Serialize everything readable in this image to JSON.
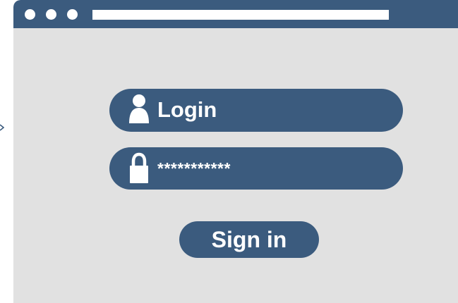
{
  "login_form": {
    "username_label": "Login",
    "password_value": "***********",
    "sign_in_label": "Sign in"
  },
  "icons": {
    "user": "user-icon",
    "lock": "lock-icon"
  },
  "colors": {
    "primary": "#3b5b7e",
    "window_background": "#e1e1e1",
    "text": "#ffffff"
  }
}
